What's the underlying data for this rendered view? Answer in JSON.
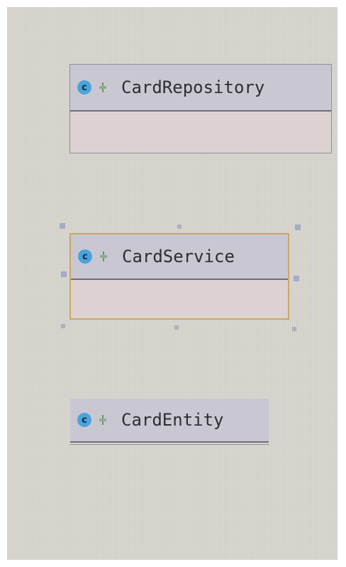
{
  "diagram": {
    "classes": [
      {
        "name": "CardRepository",
        "kind_icon": "class-c-icon",
        "badge_icon": "leaf-icon"
      },
      {
        "name": "CardService",
        "kind_icon": "class-c-icon",
        "badge_icon": "leaf-icon",
        "selected": true
      },
      {
        "name": "CardEntity",
        "kind_icon": "class-c-icon",
        "badge_icon": "leaf-icon"
      }
    ],
    "colors": {
      "canvas": "#d7d5cd",
      "header": "#c9c8d2",
      "body": "#ddd2d2",
      "class_icon": "#4aa4dc",
      "selection_border": "#c9a86a",
      "handle": "#9aa0c4"
    }
  }
}
